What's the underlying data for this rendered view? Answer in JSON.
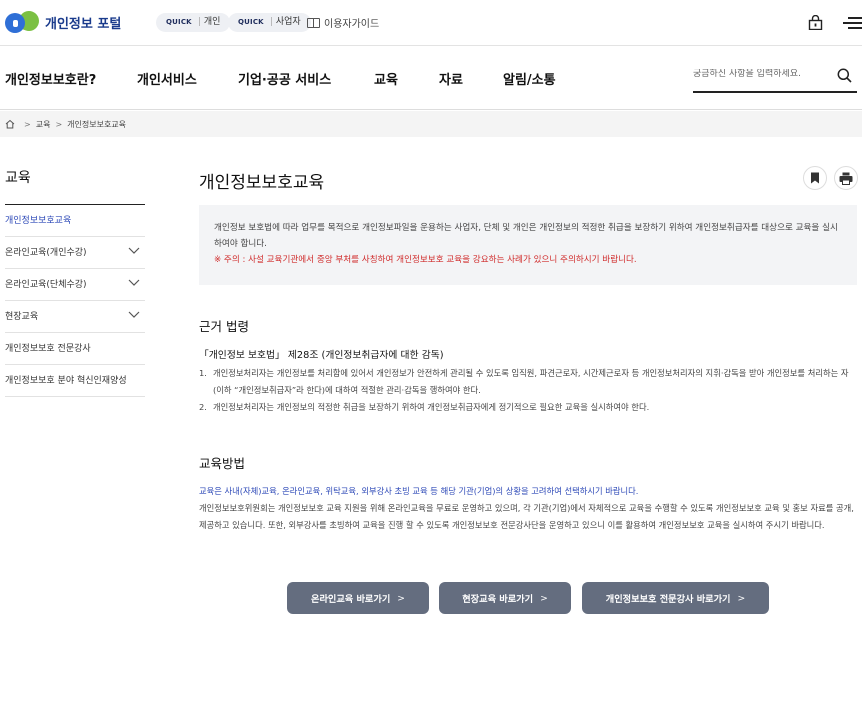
{
  "header": {
    "logo_text": "개인정보 포털",
    "quick_links": [
      {
        "tag": "QUICK",
        "label": "개인"
      },
      {
        "tag": "QUICK",
        "label": "사업자"
      }
    ],
    "guide_label": "이용자가이드"
  },
  "nav": {
    "items": [
      {
        "label": "개인정보보호란?"
      },
      {
        "label": "개인서비스"
      },
      {
        "label": "기업·공공 서비스"
      },
      {
        "label": "교육",
        "active": true
      },
      {
        "label": "자료"
      },
      {
        "label": "알림/소통"
      }
    ],
    "search_placeholder": "궁금하신 사항을 입력하세요."
  },
  "breadcrumb": [
    "교육",
    "개인정보보호교육"
  ],
  "sidebar": {
    "title": "교육",
    "items": [
      {
        "label": "개인정보보호교육",
        "active": true,
        "expandable": false
      },
      {
        "label": "온라인교육(개인수강)",
        "expandable": true
      },
      {
        "label": "온라인교육(단체수강)",
        "expandable": true
      },
      {
        "label": "현장교육",
        "expandable": true
      },
      {
        "label": "개인정보보호 전문강사",
        "expandable": false
      },
      {
        "label": "개인정보보호 분야 혁신인재양성",
        "expandable": false
      }
    ]
  },
  "main": {
    "title": "개인정보보호교육",
    "intro": {
      "text": "개인정보 보호법에 따라 업무를 목적으로 개인정보파일을 운용하는 사업자, 단체 및 개인은 개인정보의 적정한 취급을 보장하기 위하여 개인정보취급자를 대상으로 교육을 실시하여야 합니다.",
      "warning": "※ 주의 : 사설 교육기관에서 중앙 부처를 사칭하여 개인정보보호 교육을 강요하는 사례가 있으니 주의하시기 바랍니다."
    },
    "law": {
      "title": "근거 법령",
      "heading": "「개인정보 보호법」 제28조 (개인정보취급자에 대한 감독)",
      "items": [
        {
          "num": "1.",
          "text": "개인정보처리자는 개인정보를 처리함에 있어서 개인정보가 안전하게 관리될 수 있도록 임직원, 파견근로자, 시간제근로자 등 개인정보처리자의 지휘·감독을 받아 개인정보를 처리하는 자(이하 “개인정보취급자”라 한다)에 대하여 적절한 관리·감독을 행하여야 한다."
        },
        {
          "num": "2.",
          "text": "개인정보처리자는 개인정보의 적정한 취급을 보장하기 위하여 개인정보취급자에게 정기적으로 필요한 교육을 실시하여야 한다."
        }
      ]
    },
    "method": {
      "title": "교육방법",
      "lead": "교육은 사내(자체)교육, 온라인교육, 위탁교육, 외부강사 초빙 교육 등 해당 기관(기업)의 상황을 고려하여 선택하시기 바랍니다.",
      "body": "개인정보보호위원회는 개인정보보호 교육 지원을 위해 온라인교육을 무료로 운영하고 있으며, 각 기관(기업)에서 자체적으로 교육을 수행할 수 있도록 개인정보보호 교육 및 홍보 자료를 공개, 제공하고 있습니다. 또한, 외부강사를 초빙하여 교육을 진행 할 수 있도록 개인정보보호 전문강사단을 운영하고 있으니 이를 활용하여 개인정보보호 교육을 실시하여 주시기 바랍니다."
    },
    "buttons": [
      {
        "label": "온라인교육 바로가기"
      },
      {
        "label": "현장교육 바로가기"
      },
      {
        "label": "개인정보보호 전문강사 바로가기"
      }
    ]
  }
}
